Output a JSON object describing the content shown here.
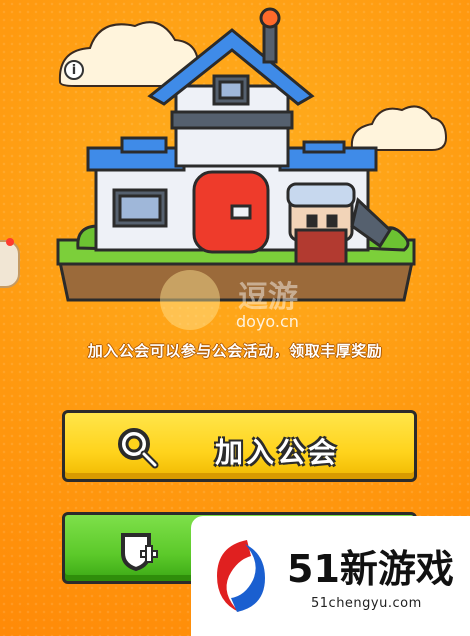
{
  "scene": {
    "info_icon": "info-icon",
    "info_glyph": "i"
  },
  "watermark_top": {
    "name": "逗游",
    "url": "doyo.cn"
  },
  "description": "加入公会可以参与公会活动，领取丰厚奖励",
  "buttons": {
    "join_label": "加入公会",
    "join_icon": "search-icon",
    "create_icon": "shield-plus-icon"
  },
  "watermark_bottom": {
    "title": "51新游戏",
    "url": "51chengyu.com"
  },
  "colors": {
    "background": "#ff9a10",
    "join_button": "#ffd31c",
    "create_button": "#5cc92a",
    "outline": "#2b2b2b"
  }
}
